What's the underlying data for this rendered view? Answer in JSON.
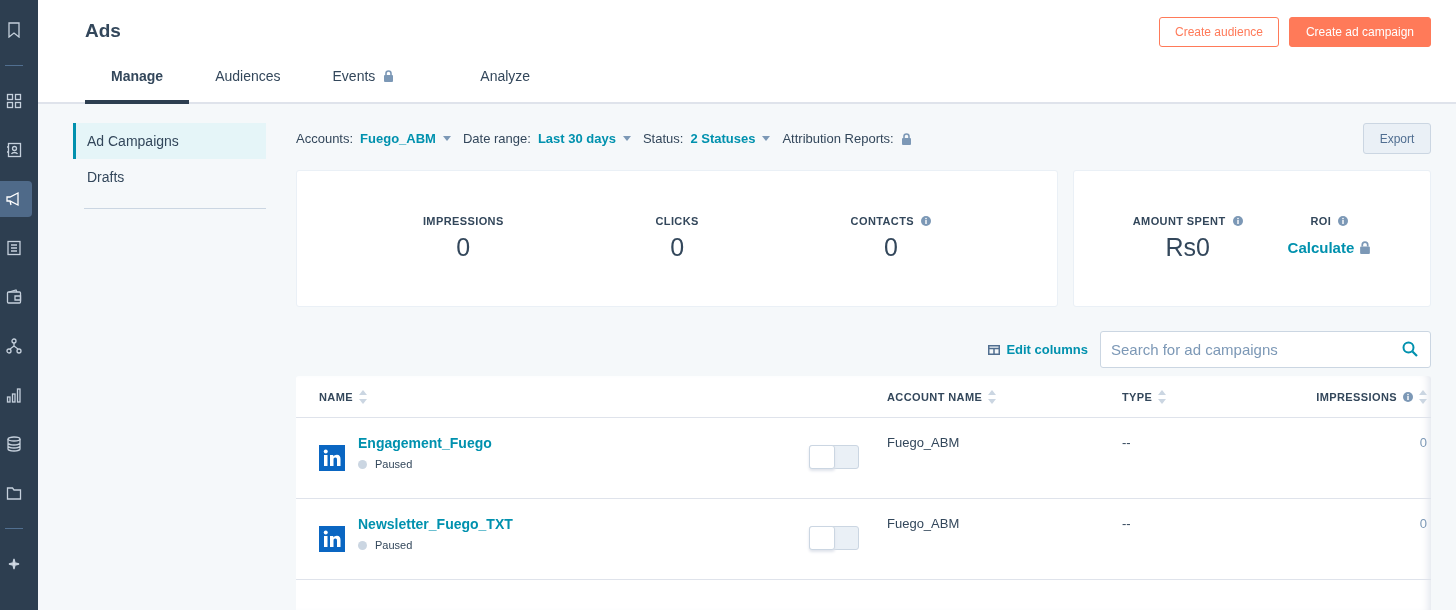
{
  "nav_rail": {
    "items": [
      {
        "kind": "bookmark",
        "selected": false
      },
      {
        "kind": "divider"
      },
      {
        "kind": "grid",
        "selected": false
      },
      {
        "kind": "contacts",
        "selected": false
      },
      {
        "kind": "megaphone",
        "selected": true
      },
      {
        "kind": "document",
        "selected": false
      },
      {
        "kind": "wallet",
        "selected": false
      },
      {
        "kind": "hierarchy",
        "selected": false
      },
      {
        "kind": "chart",
        "selected": false
      },
      {
        "kind": "database",
        "selected": false
      },
      {
        "kind": "folder",
        "selected": false
      },
      {
        "kind": "divider"
      },
      {
        "kind": "sparkle",
        "selected": false
      }
    ]
  },
  "page": {
    "title": "Ads"
  },
  "header_buttons": [
    {
      "label": "Create audience",
      "kind": "secondary"
    },
    {
      "label": "Create ad campaign",
      "kind": "primary"
    }
  ],
  "tabs": [
    {
      "label": "Manage",
      "selected": true,
      "locked": false
    },
    {
      "label": "Audiences",
      "selected": false,
      "locked": false
    },
    {
      "label": "Events",
      "selected": false,
      "locked": true
    },
    {
      "label": "Analyze",
      "selected": false,
      "locked": false
    }
  ],
  "sidebar": {
    "items": [
      {
        "label": "Ad Campaigns",
        "selected": true
      },
      {
        "label": "Drafts",
        "selected": false
      }
    ]
  },
  "filters": [
    {
      "label": "Accounts:",
      "value": "Fuego_ABM",
      "kind": "dropdown"
    },
    {
      "label": "Date range:",
      "value": "Last 30 days",
      "kind": "dropdown"
    },
    {
      "label": "Status:",
      "value": "2 Statuses",
      "kind": "dropdown"
    },
    {
      "label": "Attribution Reports:",
      "kind": "locked"
    }
  ],
  "export_button": "Export",
  "metric_cards": [
    {
      "metrics": [
        {
          "label": "IMPRESSIONS",
          "value": "0",
          "info": false,
          "kind": "number"
        },
        {
          "label": "CLICKS",
          "value": "0",
          "info": false,
          "kind": "number"
        },
        {
          "label": "CONTACTS",
          "value": "0",
          "info": true,
          "kind": "number"
        }
      ]
    },
    {
      "metrics": [
        {
          "label": "AMOUNT SPENT",
          "value": "Rs0",
          "info": true,
          "kind": "number"
        },
        {
          "label": "ROI",
          "value": "Calculate",
          "info": true,
          "kind": "locked_link"
        }
      ]
    }
  ],
  "edit_columns": "Edit columns",
  "search": {
    "placeholder": "Search for ad campaigns"
  },
  "table": {
    "columns": [
      {
        "label": "NAME",
        "info": false
      },
      {
        "label": "ACCOUNT NAME",
        "info": false
      },
      {
        "label": "TYPE",
        "info": false
      },
      {
        "label": "IMPRESSIONS",
        "info": true
      }
    ],
    "rows": [
      {
        "name": "Engagement_Fuego",
        "status": "Paused",
        "on": false,
        "account": "Fuego_ABM",
        "type": "--",
        "impressions": "0"
      },
      {
        "name": "Newsletter_Fuego_TXT",
        "status": "Paused",
        "on": false,
        "account": "Fuego_ABM",
        "type": "--",
        "impressions": "0"
      }
    ]
  }
}
